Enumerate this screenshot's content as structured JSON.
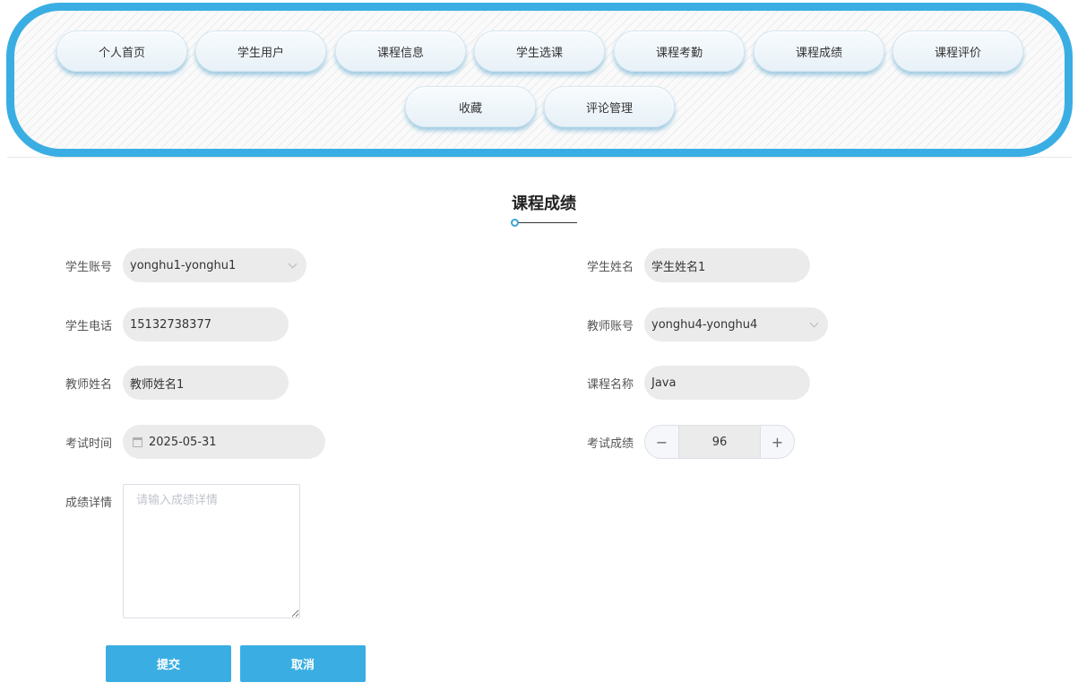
{
  "nav": {
    "items": [
      {
        "label": "个人首页"
      },
      {
        "label": "学生用户"
      },
      {
        "label": "课程信息"
      },
      {
        "label": "学生选课"
      },
      {
        "label": "课程考勤"
      },
      {
        "label": "课程成绩"
      },
      {
        "label": "课程评价"
      },
      {
        "label": "收藏"
      },
      {
        "label": "评论管理"
      }
    ]
  },
  "page": {
    "title": "课程成绩"
  },
  "form": {
    "student_account": {
      "label": "学生账号",
      "value": "yonghu1-yonghu1"
    },
    "student_name": {
      "label": "学生姓名",
      "value": "学生姓名1"
    },
    "student_phone": {
      "label": "学生电话",
      "value": "15132738377"
    },
    "teacher_account": {
      "label": "教师账号",
      "value": "yonghu4-yonghu4"
    },
    "teacher_name": {
      "label": "教师姓名",
      "value": "教师姓名1"
    },
    "course_name": {
      "label": "课程名称",
      "value": "Java"
    },
    "exam_time": {
      "label": "考试时间",
      "value": "2025-05-31"
    },
    "exam_score": {
      "label": "考试成绩",
      "value": "96",
      "minus": "−",
      "plus": "+"
    },
    "score_detail": {
      "label": "成绩详情",
      "placeholder": "请输入成绩详情"
    }
  },
  "actions": {
    "submit": "提交",
    "cancel": "取消"
  },
  "colors": {
    "accent": "#3aaee3",
    "field_bg": "#ebebeb"
  }
}
